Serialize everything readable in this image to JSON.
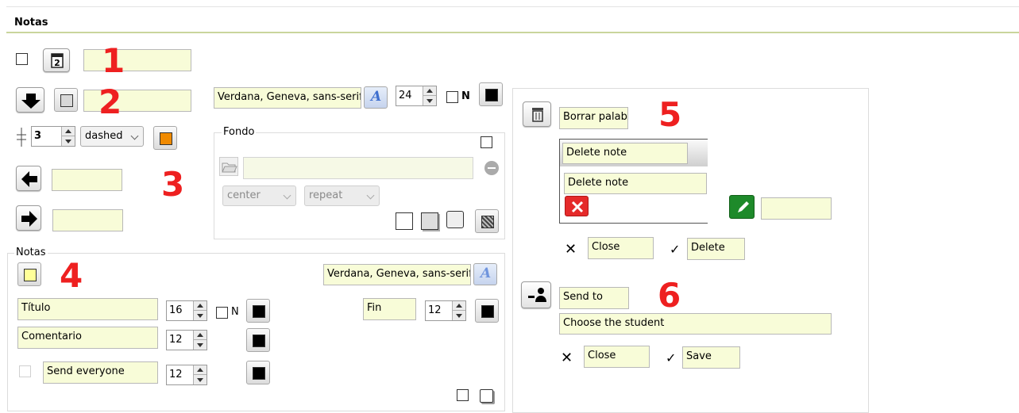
{
  "header": {
    "title": "Notas"
  },
  "section1": {
    "number": "1",
    "value": ""
  },
  "section2": {
    "number": "2",
    "value": ""
  },
  "border": {
    "width": "3",
    "style": "dashed"
  },
  "section3": {
    "number": "3",
    "left_value": "",
    "right_value": ""
  },
  "font_top": {
    "family": "Verdana, Geneva, sans-serif",
    "size": "24",
    "bold_label": "N"
  },
  "fondo": {
    "legend": "Fondo",
    "path": "",
    "position": "center",
    "repeat": "repeat"
  },
  "notas": {
    "legend": "Notas",
    "number": "4",
    "font_family": "Verdana, Geneva, sans-serif",
    "title_field": "Título",
    "title_size": "16",
    "bold_label": "N",
    "comment_field": "Comentario",
    "comment_size": "12",
    "send_field": "Send everyone",
    "send_size": "12",
    "end_field": "Fin",
    "end_size": "12"
  },
  "delete_section": {
    "number": "5",
    "erase_field": "Borrar palabra",
    "delete_note_header": "Delete note",
    "delete_note_text": "Delete note",
    "edit_value": "",
    "close": "Close",
    "delete": "Delete"
  },
  "send_section": {
    "number": "6",
    "send_to": "Send to",
    "choose": "Choose the student",
    "close": "Close",
    "save": "Save"
  },
  "colors": {
    "orange": "#f08a00",
    "yellow": "#ffff99",
    "black": "#000000",
    "red": "#e52a2a",
    "green": "#1e8a2a",
    "field": "#f8fcd8"
  }
}
